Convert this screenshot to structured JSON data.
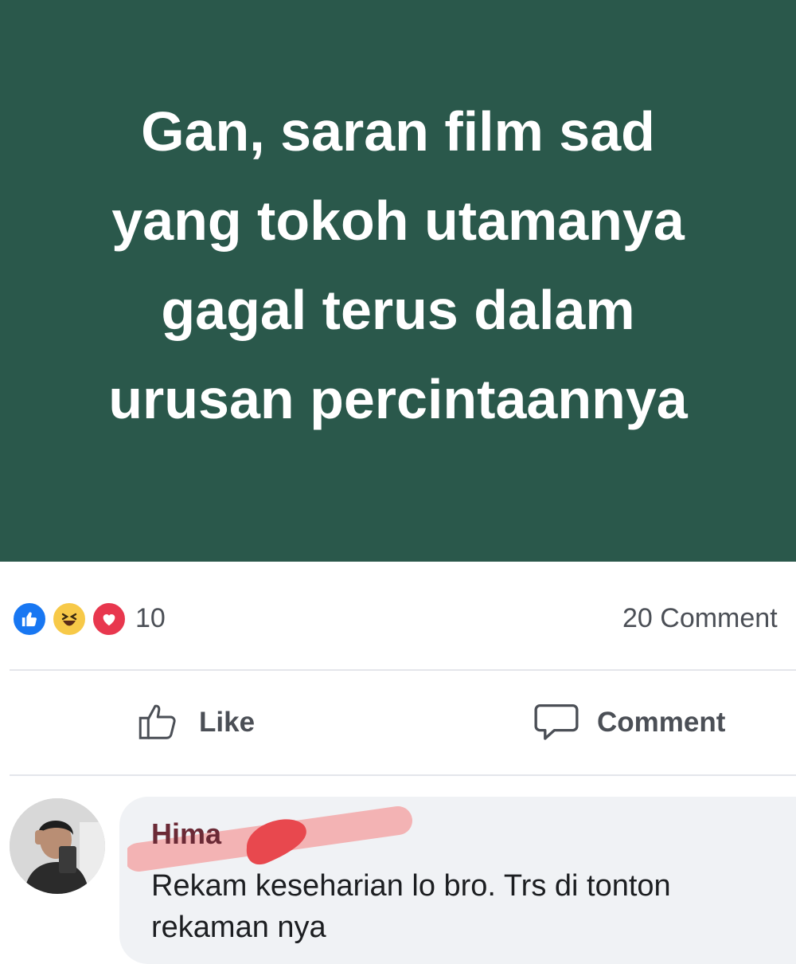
{
  "post": {
    "banner_text": "Gan, saran film sad\nyang tokoh utamanya\ngagal terus dalam\nurusan percintaannya",
    "banner_color": "#2a584b"
  },
  "reactions": {
    "icons": [
      "like-icon",
      "haha-icon",
      "love-icon"
    ],
    "count": "10",
    "comments_count": "20 Comment"
  },
  "actions": {
    "like_label": "Like",
    "comment_label": "Comment"
  },
  "comment": {
    "author": "Hima",
    "text": "Rekam keseharian lo bro. Trs di tonton rekaman nya"
  }
}
